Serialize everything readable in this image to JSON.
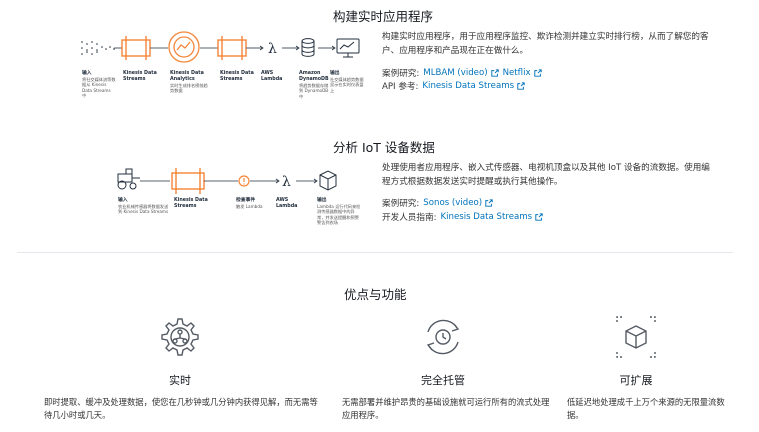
{
  "section1": {
    "title": "构建实时应用程序",
    "description": "构建实时应用程序，用于应用程序监控、欺诈检测并建立实时排行榜，从而了解您的客户、应用程序和产品现在正在做什么。",
    "case_label": "案例研究:",
    "case_links": [
      "MLBAM (video)",
      "Netflix"
    ],
    "api_label": "API 参考:",
    "api_link": "Kinesis Data Streams",
    "diagram": [
      {
        "label": "输入",
        "sub": "将社交媒体流等数据从 Kinesis Data Streams 中"
      },
      {
        "label": "Kinesis Data Streams",
        "sub": ""
      },
      {
        "label": "Kinesis Data Analytics",
        "sub": "实时生成排名榜前趋势数据"
      },
      {
        "label": "Kinesis Data Streams",
        "sub": ""
      },
      {
        "label": "AWS Lambda",
        "sub": ""
      },
      {
        "label": "Amazon DynamoDB",
        "sub": "将趋势数据存储到 DynamoDB 中"
      },
      {
        "label": "输出",
        "sub": "社交媒体趋势数据显示在实时仪表盘上"
      }
    ]
  },
  "section2": {
    "title": "分析 IoT 设备数据",
    "description": "处理使用者应用程序、嵌入式传感器、电视机顶盒以及其他 IoT 设备的流数据。使用编程方式根据数据发送实时提醒或执行其他操作。",
    "case_label": "案例研究:",
    "case_link": "Sonos (video)",
    "dev_label": "开发人员指南:",
    "dev_link": "Kinesis Data Streams",
    "diagram": [
      {
        "label": "输入",
        "sub": "农业机械传感器将数据发送到 Kinesis Data Streams"
      },
      {
        "label": "Kinesis Data Streams",
        "sub": ""
      },
      {
        "label": "检查事件",
        "sub": "触发 Lambda"
      },
      {
        "label": "AWS Lambda",
        "sub": ""
      },
      {
        "label": "输出",
        "sub": "Lambda 运行代码来检测传感器数据中的异常，并发送提醒和预警警告到农场"
      }
    ]
  },
  "features": {
    "title": "优点与功能",
    "items": [
      {
        "title": "实时",
        "desc": "即时提取、缓冲及处理数据，使您在几秒钟或几分钟内获得见解，而无需等待几小时或几天。"
      },
      {
        "title": "完全托管",
        "desc": "无需部署并维护昂贵的基础设施就可运行所有的流式处理应用程序。"
      },
      {
        "title": "可扩展",
        "desc": "低延迟地处理成千上万个来源的无限量流数据。"
      }
    ]
  },
  "colors": {
    "link": "#0073bb",
    "pipe": "#f58536",
    "line": "#232f3e",
    "text": "#333333"
  }
}
